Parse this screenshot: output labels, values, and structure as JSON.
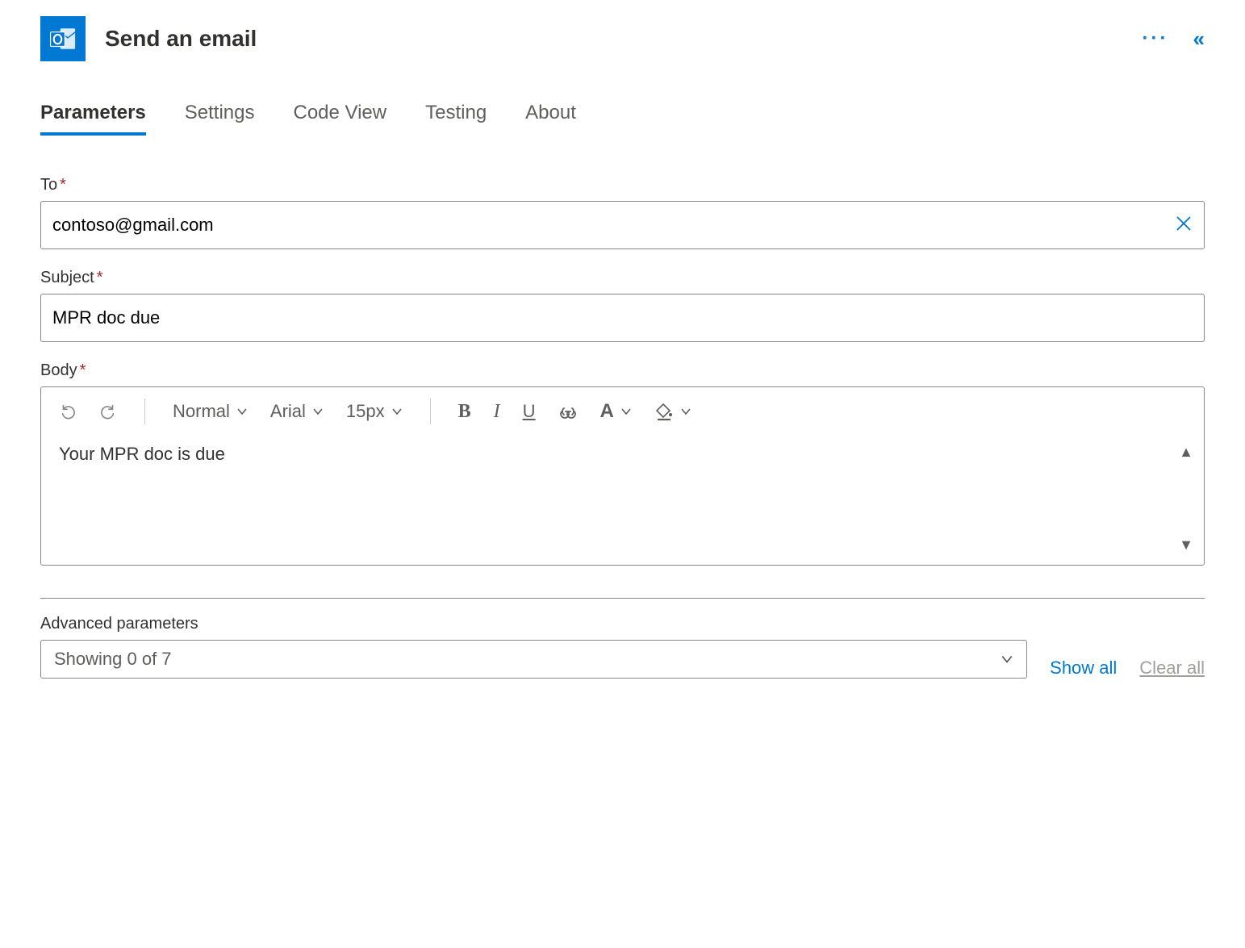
{
  "header": {
    "title": "Send an email"
  },
  "tabs": {
    "parameters": "Parameters",
    "settings": "Settings",
    "codeview": "Code View",
    "testing": "Testing",
    "about": "About"
  },
  "fields": {
    "to_label": "To",
    "to_value": "contoso@gmail.com",
    "subject_label": "Subject",
    "subject_value": "MPR doc due",
    "body_label": "Body",
    "body_value": "Your MPR doc is due"
  },
  "toolbar": {
    "style": "Normal",
    "font": "Arial",
    "size": "15px"
  },
  "advanced": {
    "label": "Advanced parameters",
    "showing": "Showing 0 of 7",
    "show_all": "Show all",
    "clear_all": "Clear all"
  }
}
